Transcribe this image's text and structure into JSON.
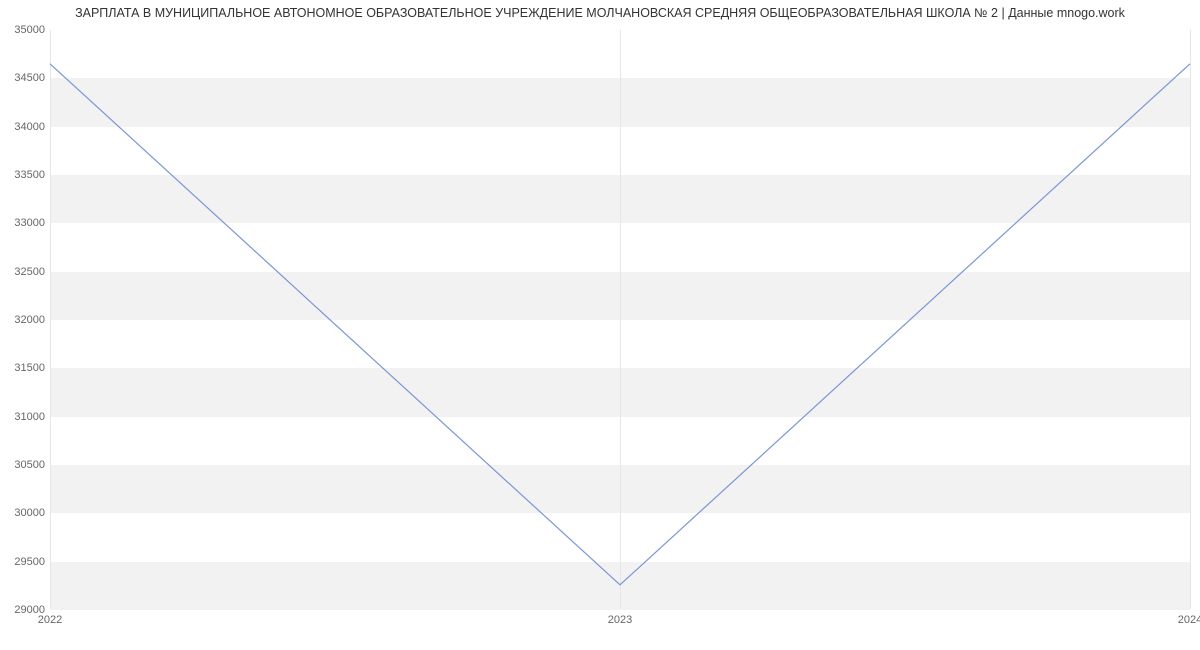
{
  "chart_data": {
    "type": "line",
    "title": "ЗАРПЛАТА В МУНИЦИПАЛЬНОЕ АВТОНОМНОЕ ОБРАЗОВАТЕЛЬНОЕ УЧРЕЖДЕНИЕ МОЛЧАНОВСКАЯ СРЕДНЯЯ ОБЩЕОБРАЗОВАТЕЛЬНАЯ ШКОЛА № 2 | Данные mnogo.work",
    "categories": [
      "2022",
      "2023",
      "2024"
    ],
    "x": [
      2022,
      2023,
      2024
    ],
    "values": [
      34650,
      29250,
      34650
    ],
    "xlabel": "",
    "ylabel": "",
    "ylim": [
      29000,
      35000
    ],
    "y_ticks": [
      29000,
      29500,
      30000,
      30500,
      31000,
      31500,
      32000,
      32500,
      33000,
      33500,
      34000,
      34500,
      35000
    ],
    "x_ticks": [
      "2022",
      "2023",
      "2024"
    ],
    "series_color": "#7997d4",
    "grid": true
  }
}
